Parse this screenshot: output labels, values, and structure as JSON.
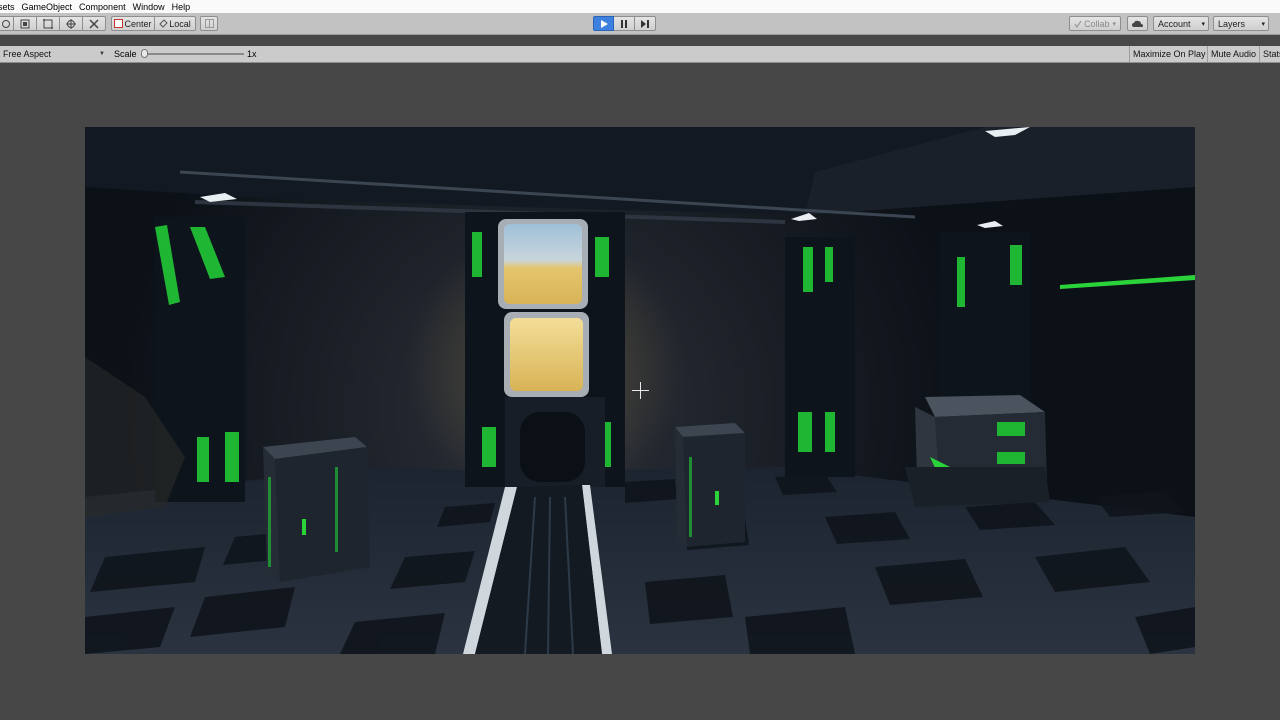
{
  "menu": {
    "items": [
      "sets",
      "GameObject",
      "Component",
      "Window",
      "Help"
    ]
  },
  "toolbar": {
    "tools": [
      "view-tool",
      "move-tool",
      "rect-tool",
      "transform-tool",
      "custom-tool"
    ],
    "pivot_label": "Center",
    "rotation_label": "Local",
    "collab_label": "Collab",
    "account_label": "Account",
    "layers_label": "Layers",
    "play_state": "playing"
  },
  "game_toolbar": {
    "aspect_label": "Free Aspect",
    "scale_label": "Scale",
    "scale_value": "1x",
    "scale_level": 0,
    "maximize_label": "Maximize On Play",
    "mute_label": "Mute Audio",
    "stats_label": "Stats"
  },
  "colors": {
    "accent": "#3d80df",
    "toolbar_bg": "#c2c2c2",
    "editor_bg": "#474747",
    "scene_green": "#2bd33a",
    "window_light": "#f3d98a"
  }
}
